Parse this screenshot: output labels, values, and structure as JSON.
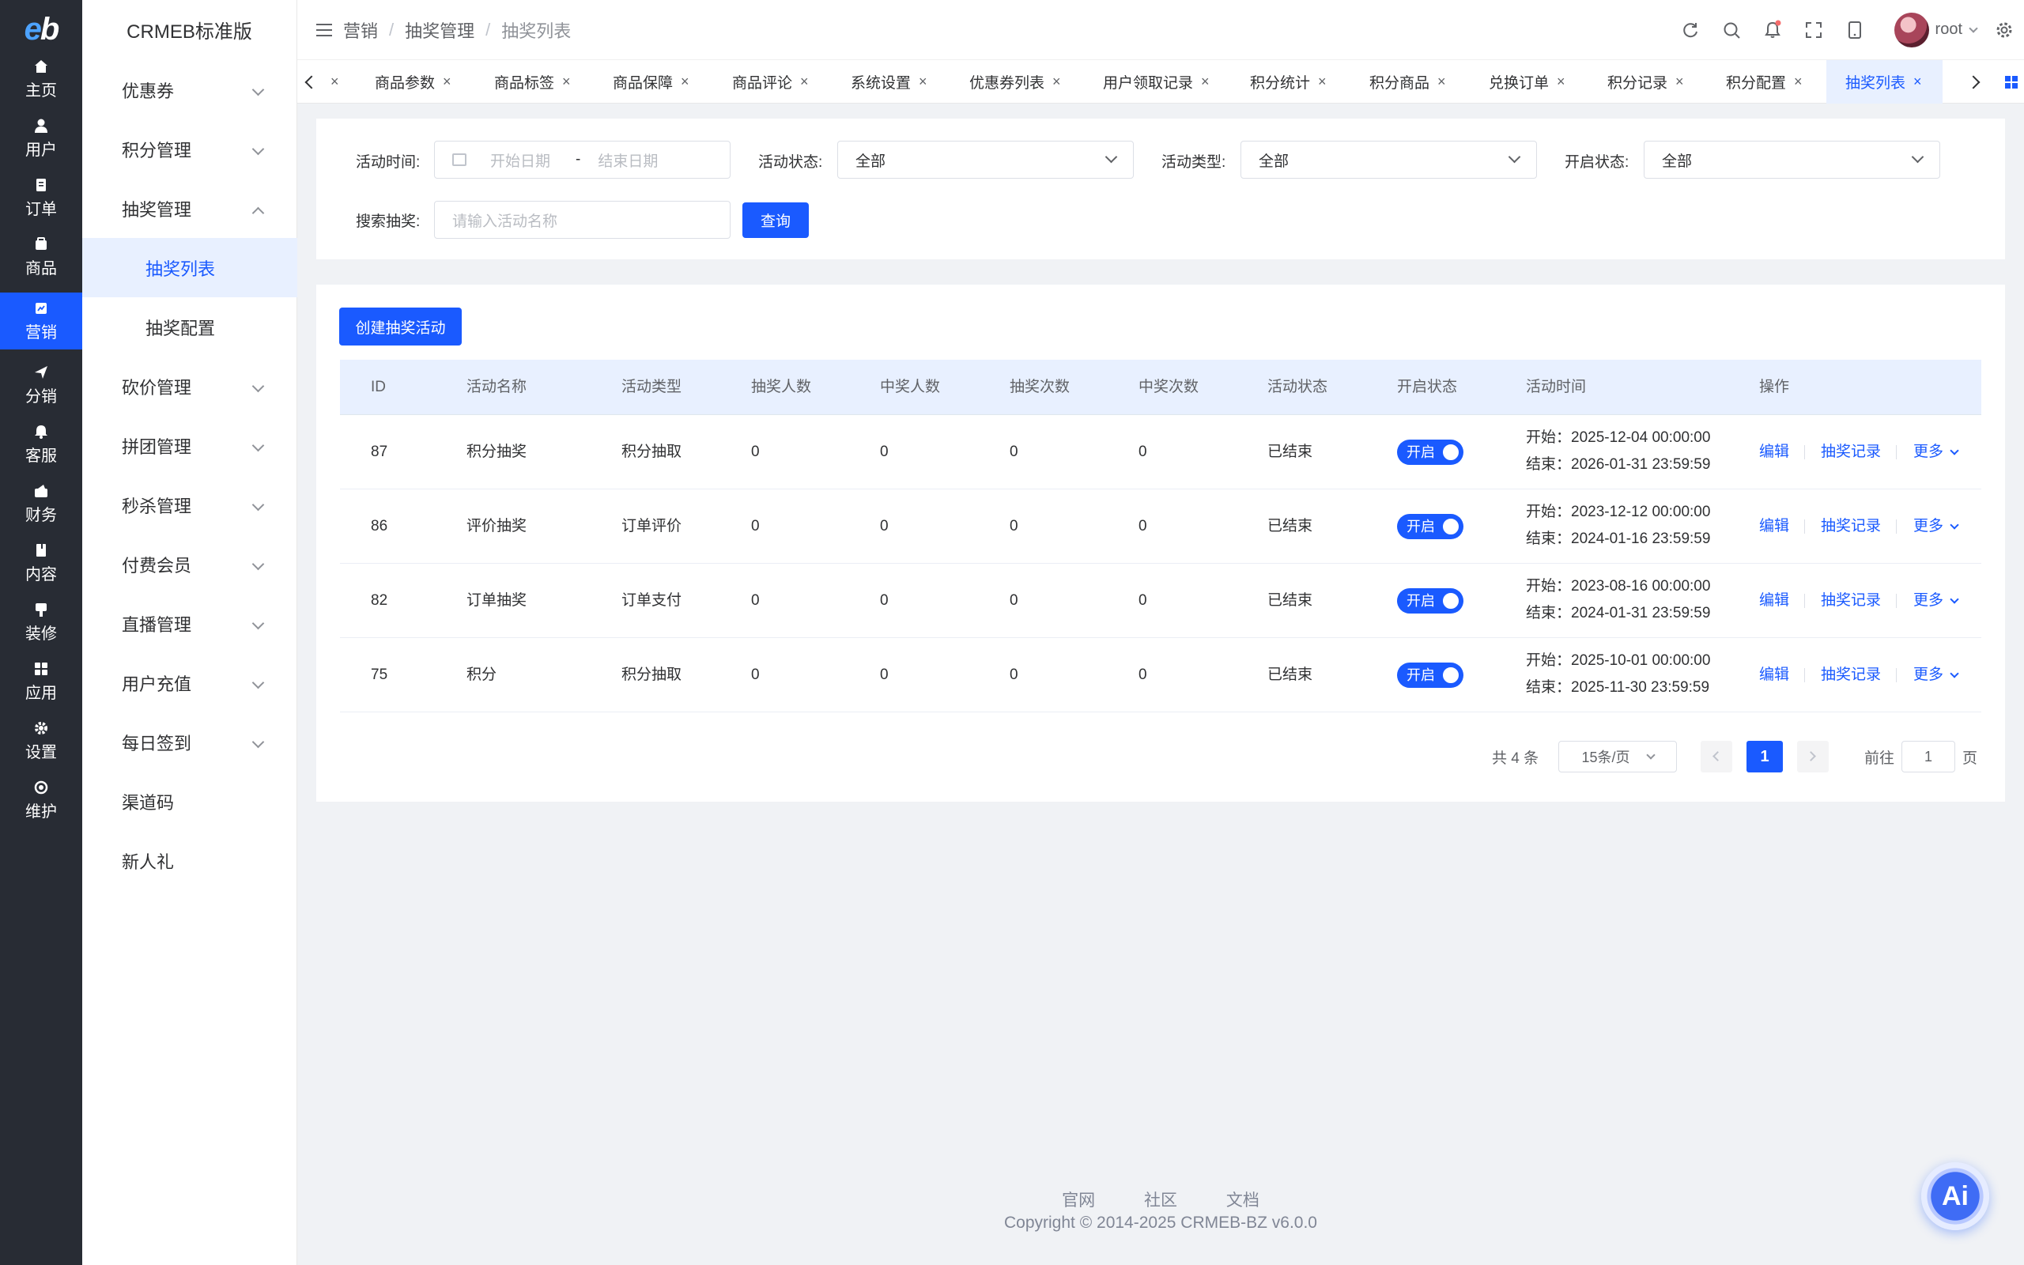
{
  "brand": {
    "logo_e": "e",
    "logo_b": "b",
    "title": "CRMEB标准版"
  },
  "rail": [
    {
      "label": "主页",
      "icon": "home-icon"
    },
    {
      "label": "用户",
      "icon": "user-icon"
    },
    {
      "label": "订单",
      "icon": "order-icon"
    },
    {
      "label": "商品",
      "icon": "goods-icon"
    },
    {
      "label": "营销",
      "icon": "marketing-icon"
    },
    {
      "label": "分销",
      "icon": "distribution-icon"
    },
    {
      "label": "客服",
      "icon": "service-icon"
    },
    {
      "label": "财务",
      "icon": "finance-icon"
    },
    {
      "label": "内容",
      "icon": "content-icon"
    },
    {
      "label": "装修",
      "icon": "decorate-icon"
    },
    {
      "label": "应用",
      "icon": "apps-icon"
    },
    {
      "label": "设置",
      "icon": "settings-icon"
    },
    {
      "label": "维护",
      "icon": "maintain-icon"
    }
  ],
  "subnav": [
    {
      "label": "优惠券"
    },
    {
      "label": "积分管理"
    },
    {
      "label": "抽奖管理"
    },
    {
      "label": "抽奖列表"
    },
    {
      "label": "抽奖配置"
    },
    {
      "label": "砍价管理"
    },
    {
      "label": "拼团管理"
    },
    {
      "label": "秒杀管理"
    },
    {
      "label": "付费会员"
    },
    {
      "label": "直播管理"
    },
    {
      "label": "用户充值"
    },
    {
      "label": "每日签到"
    },
    {
      "label": "渠道码"
    },
    {
      "label": "新人礼"
    }
  ],
  "breadcrumb": [
    "营销",
    "抽奖管理",
    "抽奖列表"
  ],
  "separator": "/",
  "user": {
    "name": "root"
  },
  "tags": [
    "商品参数",
    "商品标签",
    "商品保障",
    "商品评论",
    "系统设置",
    "优惠券列表",
    "用户领取记录",
    "积分统计",
    "积分商品",
    "兑换订单",
    "积分记录",
    "积分配置",
    "抽奖列表"
  ],
  "tag_close": "×",
  "filters": {
    "time_label": "活动时间:",
    "start_placeholder": "开始日期",
    "dash": "-",
    "end_placeholder": "结束日期",
    "status_label": "活动状态:",
    "status_value": "全部",
    "type_label": "活动类型:",
    "type_value": "全部",
    "open_label": "开启状态:",
    "open_value": "全部",
    "search_label": "搜索抽奖:",
    "search_placeholder": "请输入活动名称",
    "query_button": "查询"
  },
  "create_button": "创建抽奖活动",
  "table": {
    "headers": [
      "ID",
      "活动名称",
      "活动类型",
      "抽奖人数",
      "中奖人数",
      "抽奖次数",
      "中奖次数",
      "活动状态",
      "开启状态",
      "活动时间",
      "操作"
    ],
    "switch_label": "开启",
    "ops": {
      "edit": "编辑",
      "records": "抽奖记录",
      "more": "更多"
    },
    "rows": [
      {
        "id": "87",
        "name": "积分抽奖",
        "type": "积分抽取",
        "draw_users": "0",
        "win_users": "0",
        "draw_times": "0",
        "win_times": "0",
        "status": "已结束",
        "start": "开始：2025-12-04 00:00:00",
        "end": "结束：2026-01-31 23:59:59"
      },
      {
        "id": "86",
        "name": "评价抽奖",
        "type": "订单评价",
        "draw_users": "0",
        "win_users": "0",
        "draw_times": "0",
        "win_times": "0",
        "status": "已结束",
        "start": "开始：2023-12-12 00:00:00",
        "end": "结束：2024-01-16 23:59:59"
      },
      {
        "id": "82",
        "name": "订单抽奖",
        "type": "订单支付",
        "draw_users": "0",
        "win_users": "0",
        "draw_times": "0",
        "win_times": "0",
        "status": "已结束",
        "start": "开始：2023-08-16 00:00:00",
        "end": "结束：2024-01-31 23:59:59"
      },
      {
        "id": "75",
        "name": "积分",
        "type": "积分抽取",
        "draw_users": "0",
        "win_users": "0",
        "draw_times": "0",
        "win_times": "0",
        "status": "已结束",
        "start": "开始：2025-10-01 00:00:00",
        "end": "结束：2025-11-30 23:59:59"
      }
    ]
  },
  "pagination": {
    "total": "共 4 条",
    "page_size": "15条/页",
    "current": "1",
    "goto_label": "前往",
    "goto_value": "1",
    "page_unit": "页"
  },
  "footer": {
    "links": [
      "官网",
      "社区",
      "文档"
    ],
    "copyright": "Copyright © 2014-2025 CRMEB-BZ v6.0.0"
  },
  "ai_badge": "Ai",
  "colors": {
    "primary": "#1a5aff",
    "rail_bg": "#282c34",
    "active_bg": "#e8f0ff"
  }
}
